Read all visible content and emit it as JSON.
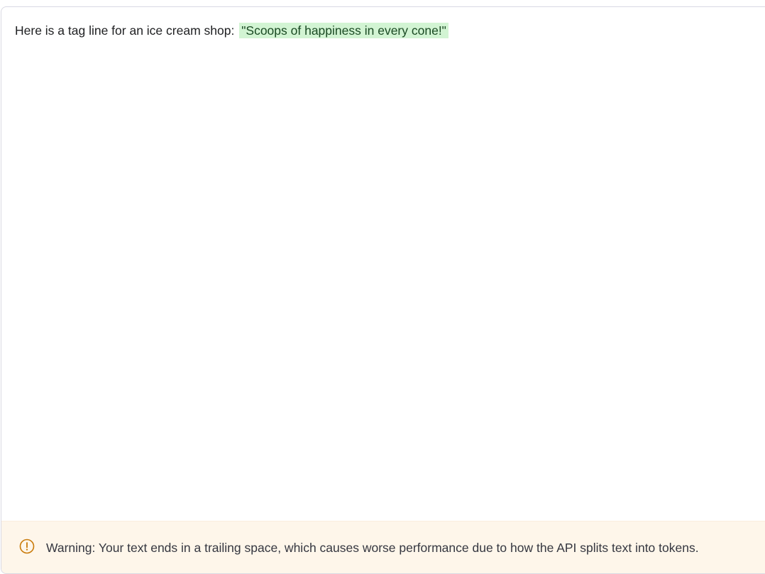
{
  "editor": {
    "prompt_text": "Here is a tag line for an ice cream shop: ",
    "completion_text": "\"Scoops of happiness in every cone!\"",
    "completion_highlight_color": "#d2f4d3"
  },
  "warning": {
    "icon": "alert-circle-icon",
    "icon_color": "#c97a09",
    "background_color": "#fef6ea",
    "message": "Warning: Your text ends in a trailing space, which causes worse performance due to how the API splits text into tokens."
  }
}
